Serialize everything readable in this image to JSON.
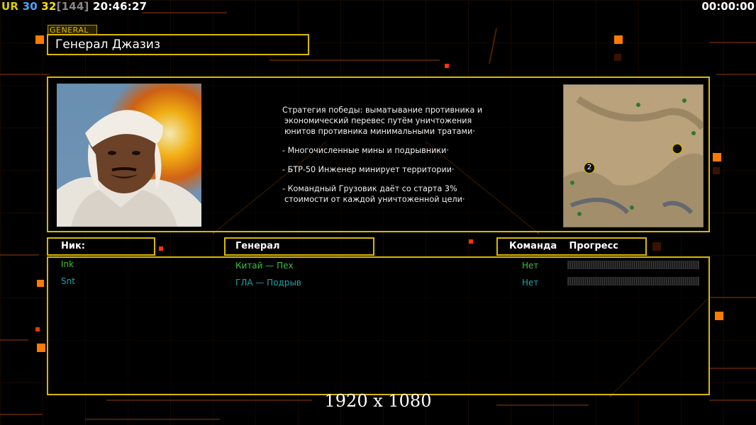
{
  "hud": {
    "tag": "UR",
    "fps_a": "30",
    "fps_b": "32",
    "latency": "[144]",
    "clock": "20:46:27",
    "timer": "00:00:00"
  },
  "general": {
    "tag": "GENERAL",
    "name": "Генерал Джазиз",
    "description": [
      "Стратегия победы: выматывание противника и",
      "экономический перевес путём уничтожения",
      "юнитов противника минимальными тратами·",
      "",
      "- Многочисленные мины и подрывники·",
      "",
      "- БТР-50 Инженер минирует территории·",
      "",
      "- Командный Грузовик даёт со старта 3%",
      "стоимости от каждой уничтоженной цели·"
    ]
  },
  "map": {
    "marker_label": "2"
  },
  "table": {
    "headers": {
      "nick": "Ник:",
      "general": "Генерал",
      "team": "Команда",
      "progress": "Прогресс"
    },
    "rows": [
      {
        "nick": "Ink",
        "general": "Китай — Пех",
        "team": "Нет",
        "progress": 0,
        "color": "#3cc33c"
      },
      {
        "nick": "Snt",
        "general": "ГЛА — Подрыв",
        "team": "Нет",
        "progress": 0,
        "color": "#1fa3a8"
      }
    ]
  },
  "watermark": "1920 x 1080",
  "colors": {
    "frame": "#d9b800",
    "accent_orange": "#ff7a00",
    "grid": "#4a1a00"
  }
}
